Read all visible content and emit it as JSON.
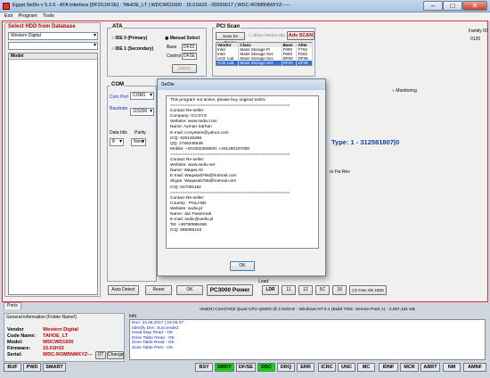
{
  "window": {
    "title": "Egypt SeDiv v 5.2.0 - ATA Interface [DF20,DF2E] : TAHOE_LT | WDCWD1600 : 15.01H15 - 00030017 | WDC-ROM5NMXYZ-----"
  },
  "menu": [
    "Exit",
    "Program",
    "Tools"
  ],
  "hdd_db": {
    "title": "Select HDD from Database",
    "vendor": "Western Digital",
    "family": "",
    "model_label": "Model"
  },
  "ata": {
    "title": "ATA",
    "ide0": "IDE 0 (Primary)",
    "ide1": "IDE 1 (Secondary)",
    "manual": "Manual Select",
    "base_label": "Base",
    "base_value": "DF20",
    "control_label": "Control",
    "control_value": "DF2E",
    "select": "Select"
  },
  "pci": {
    "title": "PCI Scan",
    "scan_btn": "Scan for Device",
    "show_vendor": "Show Vendor Info",
    "adv_scan": "Adv SCAN",
    "headers": [
      "Vendor",
      "Class",
      "Base",
      "Alter"
    ],
    "rows": [
      [
        "Intel",
        "Mass Storage Pi",
        "F000",
        "F702"
      ],
      [
        "Intel",
        "Mass Storage Sec",
        "F600",
        "F502"
      ],
      [
        "ACE Lab",
        "Mass Storage Sec",
        "DF00",
        "DF0E"
      ],
      [
        "ACE Lab",
        "Mass Storage Sec",
        "DF20",
        "DF2E"
      ]
    ]
  },
  "family": {
    "label": "Family ID",
    "value": "0125"
  },
  "com": {
    "title": "COM",
    "com_port_label": "Com Port",
    "com_port": "COM1",
    "baudrate_label": "Baudrate",
    "baudrate": "115200",
    "databits_label": "Data bits",
    "databits": "8",
    "parity_label": "Parity",
    "parity": "None"
  },
  "right": {
    "monitoring": "Monitoring",
    "type_text": "Type: 1 - 312581807|0",
    "firmware_rev": "ro Fw Rev"
  },
  "dialog": {
    "title": "SeDiv",
    "ok": "OK",
    "lines": [
      "This program not active, please buy original SeDiv",
      "================================================",
      "Contact Re-seller:",
      "Company: ICCSYS",
      "Website: www.sediv.com",
      "Name:    Ayman Sarhan",
      "E-mail:  iccsystem@yahoo.com",
      "ICQ:     626146286",
      "QQ:      2766346538",
      "Mobile: +201002359000; +201280107000",
      "================================================",
      "Contact Re-seller:",
      "Website: www.sediv.net",
      "Name:    Waqas Ali",
      "E-mail:  Waqasali766@hotmail.com",
      "Skype:   Waqasali766@hotmail.com",
      "ICQ:     617081152",
      "================================================",
      "Contact Re-seller:",
      "Country : POLAND",
      "Website: sediv.pl",
      "Name:    Jan Pasternak",
      "E-mail:  sediv@sediv.pl",
      "Tel:     +48790886486",
      "ICQ:     685085103"
    ]
  },
  "bottom_buttons": [
    "Auto Detect",
    "Reset",
    "OK"
  ],
  "pc3000": "PC3000 Power",
  "load": {
    "label": "Load",
    "buttons": [
      "LDR",
      "11",
      "12",
      "5C",
      "18",
      "Ch Fam OK HDD"
    ]
  },
  "tab": "Ports",
  "info": {
    "title": "General information (Folder Name!)",
    "vendor_label": "Vendor",
    "vendor": "Western Digital",
    "codename_label": "Code Name:",
    "codename": "TAHOE_LT",
    "model_label": "Model:",
    "model": "WDCWD1600",
    "firmware_label": "Firmware:",
    "firmware": "15.01H15",
    "serial_label": "Serial:",
    "serial": "WDC-ROM5NMXYZ---",
    "ot": "OT",
    "change": "Change"
  },
  "log": {
    "title": "Info",
    "cpu": "Intel(R) Core(TM)2 Quad CPU   Q9300 @ 2.50GHz - Windows NT 6.1 (Build 7601: Service Pack 1) - 2,097,151 KB",
    "lines": [
      "Run: 24.06.2017 | 16.06.37",
      "Identify Dev: Succeeded",
      "Head Map Read - OK",
      "Drive Table Read - OK",
      "Zone Table Read - OK",
      "Zone Table PSN - OK"
    ]
  },
  "status_left": [
    "BUF",
    "PWD",
    "SMART"
  ],
  "status_right": [
    "BSY",
    "DRDY",
    "DF/SE",
    "DSC",
    "DRQ",
    "ERR",
    "ICRC",
    "UNC",
    "MC",
    "IDNF",
    "MCR",
    "ABRT",
    "NM",
    "AMNF"
  ],
  "colors": {
    "accent_red": "#c00000",
    "drdy_green": "#18d010",
    "link_blue": "#1040c0"
  }
}
